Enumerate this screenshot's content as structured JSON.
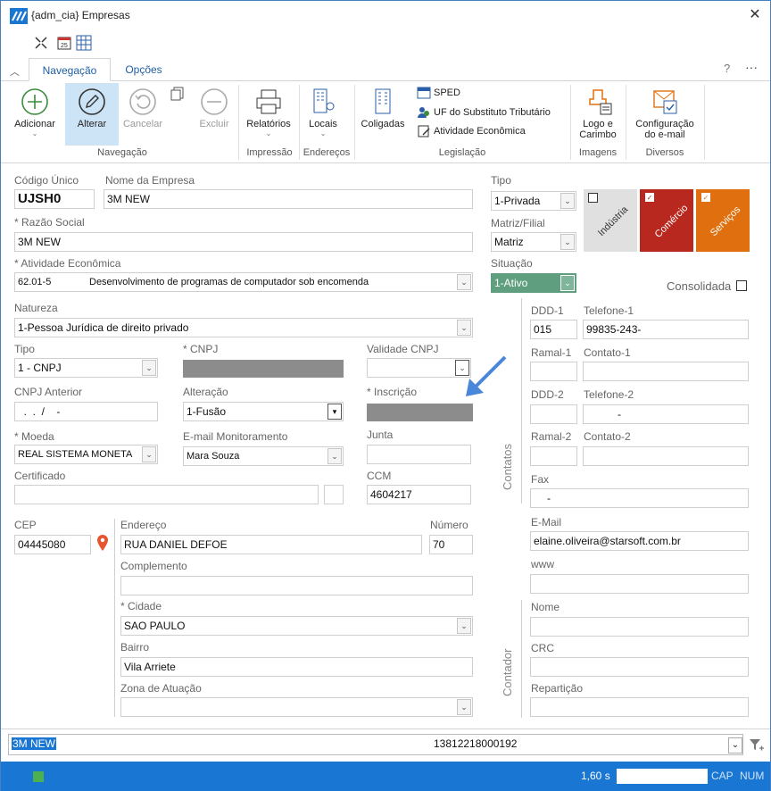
{
  "window": {
    "title": "{adm_cia}  Empresas"
  },
  "tabs": [
    "Navegação",
    "Opções"
  ],
  "ribbon": {
    "buttons": {
      "adicionar": "Adicionar",
      "alterar": "Alterar",
      "cancelar": "Cancelar",
      "excluir": "Excluir",
      "relatorios": "Relatórios",
      "locais": "Locais",
      "coligadas": "Coligadas",
      "sped": "SPED",
      "uf": "UF do Substituto Tributário",
      "atividade": "Atividade Econômica",
      "logo1": "Logo e",
      "logo2": "Carimbo",
      "config1": "Configuração",
      "config2": "do e-mail"
    },
    "groups": {
      "navegacao": "Navegação",
      "impressao": "Impressão",
      "enderecos": "Endereços",
      "legislacao": "Legislação",
      "imagens": "Imagens",
      "diversos": "Diversos"
    }
  },
  "form": {
    "codigo_unico": {
      "label": "Código Único",
      "value": "UJSH0"
    },
    "nome_empresa": {
      "label": "Nome da Empresa",
      "value": "3M NEW"
    },
    "razao_social": {
      "label": "* Razão Social",
      "value": "3M NEW"
    },
    "atividade": {
      "label": "* Atividade Econômica",
      "code": "62.01-5",
      "value": "Desenvolvimento de programas de computador sob encomenda"
    },
    "natureza": {
      "label": "Natureza",
      "value": "1-Pessoa Jurídica de direito privado"
    },
    "tipo_doc": {
      "label": "Tipo",
      "value": "1 - CNPJ"
    },
    "cnpj": {
      "label": "* CNPJ"
    },
    "validade_cnpj": {
      "label": "Validade CNPJ"
    },
    "cnpj_anterior": {
      "label": "CNPJ Anterior",
      "value": "  .  .  /    -"
    },
    "alteracao": {
      "label": "Alteração",
      "value": "1-Fusão"
    },
    "inscricao": {
      "label": "* Inscrição"
    },
    "moeda": {
      "label": "* Moeda",
      "value": "REAL  SISTEMA MONETA"
    },
    "email_monit": {
      "label": "E-mail Monitoramento",
      "value": "Mara Souza"
    },
    "junta": {
      "label": "Junta"
    },
    "certificado": {
      "label": "Certificado"
    },
    "ccm": {
      "label": "CCM",
      "value": "4604217"
    },
    "cep": {
      "label": "CEP",
      "value": "04445080"
    },
    "endereco": {
      "label": "Endereço",
      "value": "RUA DANIEL DEFOE"
    },
    "numero": {
      "label": "Número",
      "value": "70"
    },
    "complemento": {
      "label": "Complemento"
    },
    "cidade": {
      "label": "* Cidade",
      "value": "SAO PAULO"
    },
    "bairro": {
      "label": "Bairro",
      "value": "Vila Arriete"
    },
    "zona": {
      "label": "Zona de Atuação"
    },
    "tipo_emp": {
      "label": "Tipo",
      "value": "1-Privada"
    },
    "matriz": {
      "label": "Matriz/Filial",
      "value": "Matriz"
    },
    "situacao": {
      "label": "Situação",
      "value": "1-Ativo"
    },
    "consolidada": {
      "label": "Consolidada"
    },
    "tiles": {
      "industria": "Indústria",
      "comercio": "Comércio",
      "servicos": "Serviços"
    },
    "contatos_label": "Contatos",
    "contador_label": "Contador",
    "ddd1": {
      "label": "DDD-1",
      "value": "015"
    },
    "tel1": {
      "label": "Telefone-1",
      "value": "99835-243-"
    },
    "ramal1": {
      "label": "Ramal-1"
    },
    "contato1": {
      "label": "Contato-1"
    },
    "ddd2": {
      "label": "DDD-2"
    },
    "tel2": {
      "label": "Telefone-2",
      "value": "-"
    },
    "ramal2": {
      "label": "Ramal-2"
    },
    "contato2": {
      "label": "Contato-2"
    },
    "fax": {
      "label": "Fax",
      "value": "-"
    },
    "email": {
      "label": "E-Mail",
      "value": "elaine.oliveira@starsoft.com.br"
    },
    "www": {
      "label": "www"
    },
    "nome": {
      "label": "Nome"
    },
    "crc": {
      "label": "CRC"
    },
    "reparticao": {
      "label": "Repartição"
    }
  },
  "bottom": {
    "name": "3M NEW",
    "doc": "13812218000192"
  },
  "status": {
    "time": "1,60 s",
    "cap": "CAP",
    "num": "NUM"
  },
  "colors": {
    "accent": "#1976d2",
    "comercio": "#b8281e",
    "servicos": "#e0700f",
    "ativo": "#5f9f7f"
  }
}
